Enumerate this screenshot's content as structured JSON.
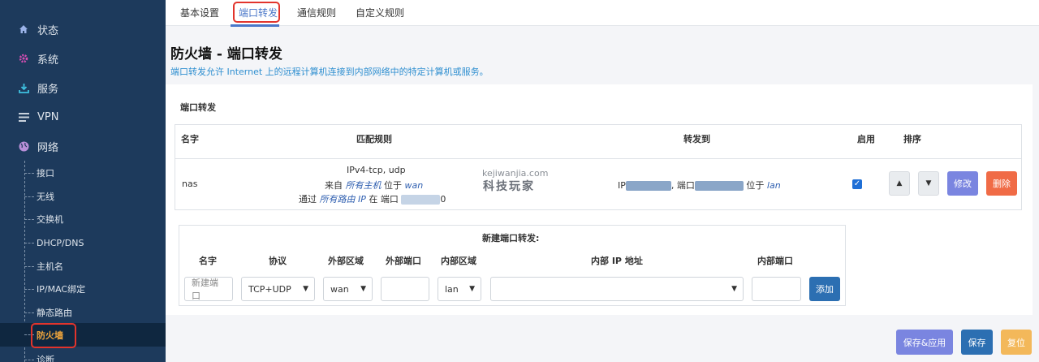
{
  "sidebar": {
    "top_items": [
      {
        "label": "状态",
        "icon": "home-icon"
      },
      {
        "label": "系统",
        "icon": "gears-icon"
      },
      {
        "label": "服务",
        "icon": "download-icon"
      },
      {
        "label": "VPN",
        "icon": "list-icon"
      },
      {
        "label": "网络",
        "icon": "globe-icon"
      }
    ],
    "sub_items": [
      "接口",
      "无线",
      "交换机",
      "DHCP/DNS",
      "主机名",
      "IP/MAC绑定",
      "静态路由",
      "防火墙",
      "诊断"
    ],
    "active_item": "防火墙"
  },
  "tabs": [
    {
      "label": "基本设置"
    },
    {
      "label": "端口转发",
      "active": true
    },
    {
      "label": "通信规则"
    },
    {
      "label": "自定义规则"
    }
  ],
  "page": {
    "title": "防火墙 - 端口转发",
    "description": "端口转发允许 Internet 上的远程计算机连接到内部网络中的特定计算机或服务。",
    "section_title": "端口转发"
  },
  "table": {
    "headers": {
      "name": "名字",
      "match": "匹配规则",
      "forward": "转发到",
      "enable": "启用",
      "sort": "排序"
    },
    "row": {
      "name": "nas",
      "match_line1": "IPv4-tcp, udp",
      "from_prefix": "来自",
      "from_host": "所有主机",
      "from_mid": "位于",
      "from_zone": "wan",
      "via_prefix": "通过",
      "via_host": "所有路由 IP",
      "via_mid": "在 端口",
      "via_tail": "0",
      "fwd_prefix": "IP",
      "fwd_mid": ", 端口",
      "fwd_zone_prefix": "位于",
      "fwd_zone": "lan",
      "enabled_mark": "✓",
      "up": "▲",
      "down": "▼",
      "edit": "修改",
      "delete": "删除"
    }
  },
  "watermark": {
    "url": "kejiwanjia.com",
    "text": "科技玩家"
  },
  "new_rule": {
    "title": "新建端口转发:",
    "headers": {
      "name": "名字",
      "protocol": "协议",
      "ext_zone": "外部区域",
      "ext_port": "外部端口",
      "int_zone": "内部区域",
      "int_ip": "内部 IP 地址",
      "int_port": "内部端口"
    },
    "name_placeholder": "新建端口",
    "protocol_value": "TCP+UDP",
    "ext_zone_value": "wan",
    "int_zone_value": "lan",
    "add": "添加"
  },
  "footer": {
    "save_apply": "保存&应用",
    "save": "保存",
    "reset": "复位"
  },
  "colors": {
    "sidebar_bg": "#1d3a5c",
    "accent": "#4a77c9",
    "edit_btn": "#7a85e0",
    "delete_btn": "#f06b46",
    "add_btn": "#2c6fb2",
    "highlight": "#e2342c",
    "reset_btn": "#f3b85a"
  }
}
